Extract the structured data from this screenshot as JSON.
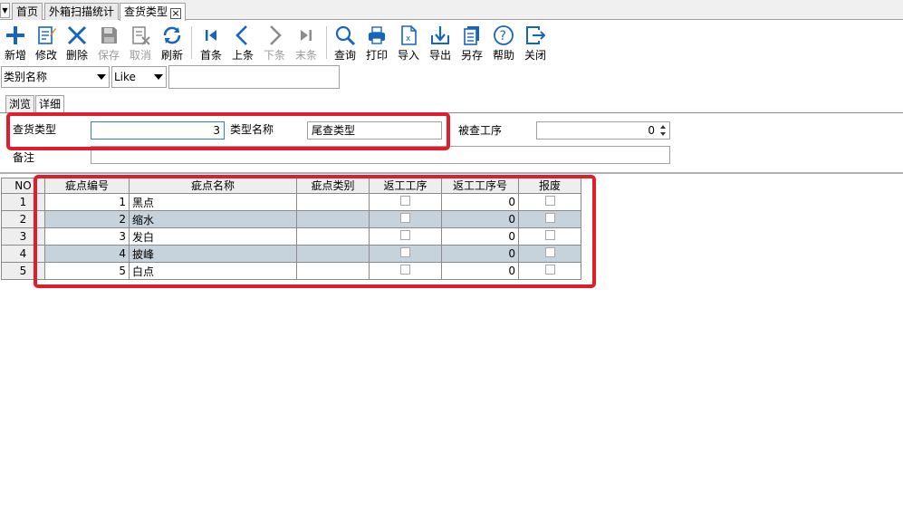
{
  "tabs": [
    {
      "label": "首页"
    },
    {
      "label": "外箱扫描统计"
    },
    {
      "label": "查货类型",
      "closable": true,
      "active": true
    }
  ],
  "toolbar": {
    "add": "新增",
    "edit": "修改",
    "delete": "删除",
    "save": "保存",
    "cancel": "取消",
    "refresh": "刷新",
    "first": "首条",
    "prev": "上条",
    "next": "下条",
    "last": "末条",
    "query": "查询",
    "print": "打印",
    "import": "导入",
    "export": "导出",
    "save_as": "另存",
    "help": "帮助",
    "close": "关闭",
    "disabled": [
      "保存",
      "取消",
      "下条",
      "末条"
    ]
  },
  "filter": {
    "field": "类别名称",
    "operator": "Like",
    "value": ""
  },
  "view_tabs": {
    "browse": "浏览",
    "detail": "详细",
    "active": "详细"
  },
  "form": {
    "inspect_type_label": "查货类型",
    "inspect_type_value": "3",
    "type_name_label": "类型名称",
    "type_name_value": "尾查类型",
    "process_label": "被查工序",
    "process_value": "0",
    "remark_label": "备注",
    "remark_value": ""
  },
  "grid": {
    "columns": [
      "NO",
      "疵点编号",
      "疵点名称",
      "疵点类别",
      "返工工序",
      "返工工序号",
      "报废"
    ],
    "rows": [
      {
        "no": "1",
        "code": "1",
        "name": "黑点",
        "category": "",
        "rework": false,
        "rework_no": "0",
        "scrap": false
      },
      {
        "no": "2",
        "code": "2",
        "name": "缩水",
        "category": "",
        "rework": false,
        "rework_no": "0",
        "scrap": false
      },
      {
        "no": "3",
        "code": "3",
        "name": "发白",
        "category": "",
        "rework": false,
        "rework_no": "0",
        "scrap": false
      },
      {
        "no": "4",
        "code": "4",
        "name": "披峰",
        "category": "",
        "rework": false,
        "rework_no": "0",
        "scrap": false
      },
      {
        "no": "5",
        "code": "5",
        "name": "白点",
        "category": "",
        "rework": false,
        "rework_no": "0",
        "scrap": false
      }
    ]
  },
  "colors": {
    "highlight": "#e21c2a",
    "alt_row": "#c6d2dc",
    "icon": "#1565c0"
  }
}
